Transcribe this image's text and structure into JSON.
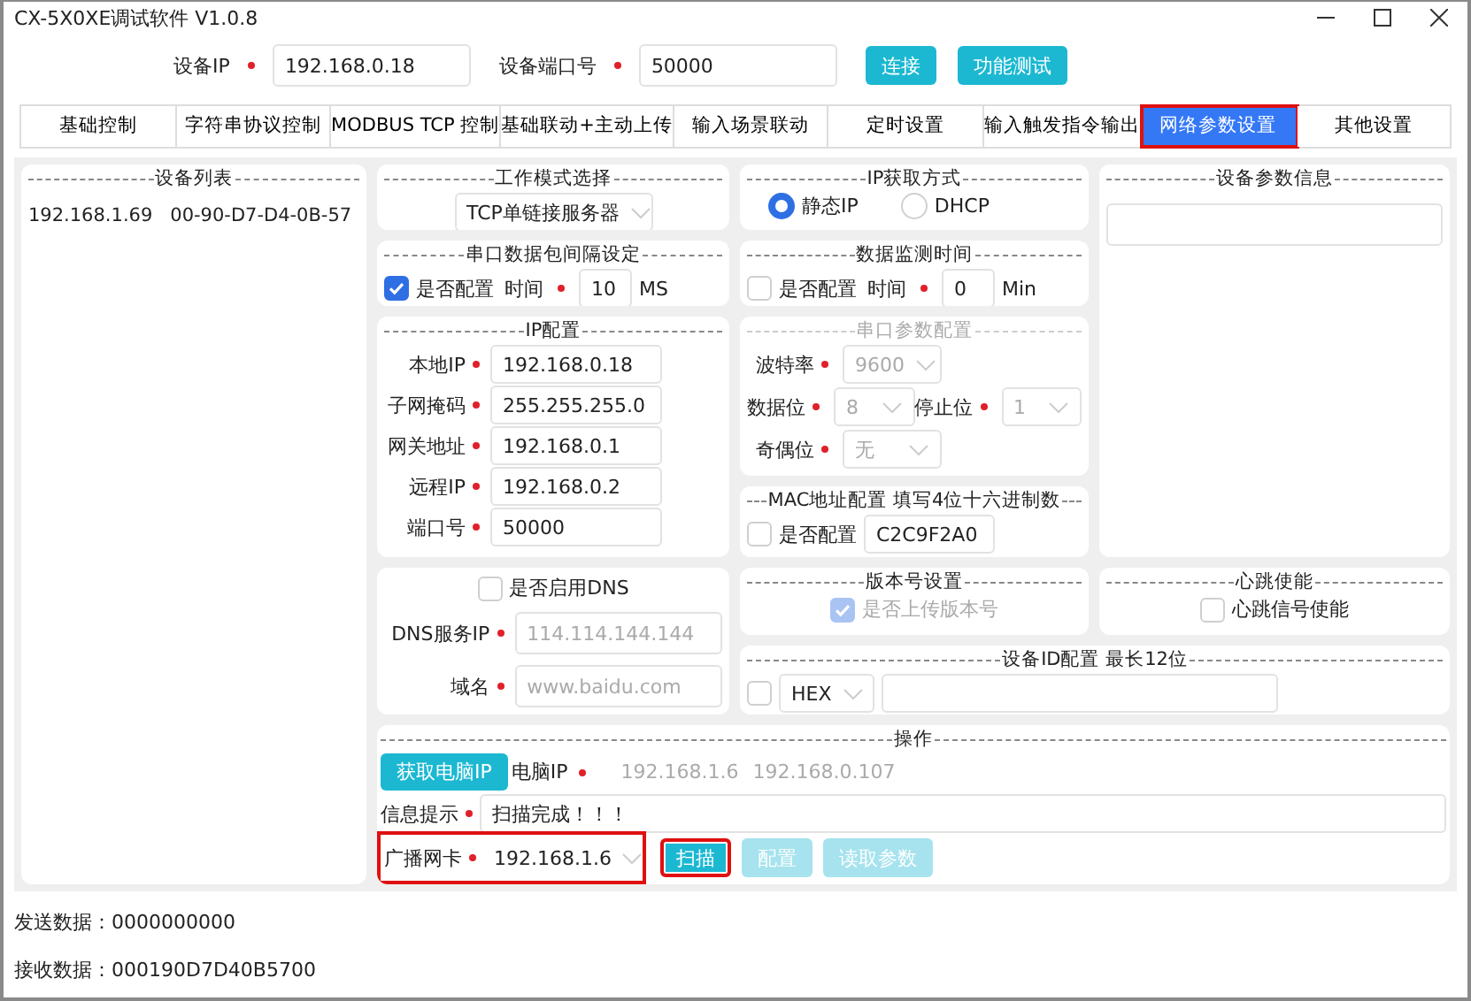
{
  "window": {
    "title": "CX-5X0XE调试软件 V1.0.8"
  },
  "connection": {
    "fields": [
      {
        "label": "设备IP",
        "value": "192.168.0.18"
      },
      {
        "label": "设备端口号",
        "value": "50000"
      }
    ],
    "buttons": [
      "连接",
      "功能测试"
    ]
  },
  "tabs": [
    {
      "label": "基础控制",
      "selected": false,
      "highlighted": false
    },
    {
      "label": "字符串协议控制",
      "selected": false,
      "highlighted": false
    },
    {
      "label": "MODBUS TCP 控制",
      "selected": false,
      "highlighted": false
    },
    {
      "label": "基础联动+主动上传",
      "selected": false,
      "highlighted": false
    },
    {
      "label": "输入场景联动",
      "selected": false,
      "highlighted": false
    },
    {
      "label": "定时设置",
      "selected": false,
      "highlighted": false
    },
    {
      "label": "输入触发指令输出",
      "selected": false,
      "highlighted": false
    },
    {
      "label": "网络参数设置",
      "selected": true,
      "highlighted": true
    },
    {
      "label": "其他设置",
      "selected": false,
      "highlighted": false
    }
  ],
  "device_list": {
    "title": "设备列表",
    "rows": [
      {
        "ip": "192.168.1.69",
        "mac": "00-90-D7-D4-0B-57"
      }
    ]
  },
  "work_mode": {
    "title": "工作模式选择",
    "value": "TCP单链接服务器"
  },
  "ip_acquisition": {
    "title": "IP获取方式",
    "options": [
      {
        "label": "静态IP",
        "selected": true
      },
      {
        "label": "DHCP",
        "selected": false
      }
    ]
  },
  "device_info": {
    "title": "设备参数信息"
  },
  "packet_interval": {
    "title": "串口数据包间隔设定",
    "checkbox": {
      "label": "是否配置",
      "checked": true
    },
    "time_label": "时间",
    "value": "10",
    "unit": "MS"
  },
  "data_monitor": {
    "title": "数据监测时间",
    "checkbox": {
      "label": "是否配置",
      "checked": false
    },
    "time_label": "时间",
    "value": "0",
    "unit": "Min"
  },
  "ip_config": {
    "title": "IP配置",
    "fields": [
      {
        "label": "本地IP",
        "value": "192.168.0.18"
      },
      {
        "label": "子网掩码",
        "value": "255.255.255.0"
      },
      {
        "label": "网关地址",
        "value": "192.168.0.1"
      },
      {
        "label": "远程IP",
        "value": "192.168.0.2"
      },
      {
        "label": "端口号",
        "value": "50000"
      }
    ]
  },
  "serial_params": {
    "title": "串口参数配置",
    "disabled": true,
    "rows": [
      [
        {
          "label": "波特率",
          "value": "9600"
        }
      ],
      [
        {
          "label": "数据位",
          "value": "8"
        },
        {
          "label": "停止位",
          "value": "1"
        }
      ],
      [
        {
          "label": "奇偶位",
          "value": "无"
        }
      ]
    ]
  },
  "mac": {
    "title": "MAC地址配置 填写4位十六进制数",
    "checkbox": {
      "label": "是否配置",
      "checked": false
    },
    "value": "C2C9F2A0"
  },
  "dns": {
    "checkbox": {
      "label": "是否启用DNS",
      "checked": false
    },
    "fields": [
      {
        "label": "DNS服务IP",
        "placeholder": "114.114.144.144"
      },
      {
        "label": "域名",
        "placeholder": "www.baidu.com"
      }
    ]
  },
  "version": {
    "title": "版本号设置",
    "checkbox": {
      "label": "是否上传版本号",
      "checked": true,
      "disabled": true
    }
  },
  "heartbeat": {
    "title": "心跳使能",
    "checkbox": {
      "label": "心跳信号使能",
      "checked": false
    }
  },
  "device_id": {
    "title": "设备ID配置  最长12位",
    "checked": false,
    "format": "HEX"
  },
  "operations": {
    "title": "操作",
    "get_ip_button": "获取电脑IP",
    "pc_ip_label": "电脑IP",
    "pc_ips": [
      "192.168.1.6",
      "192.168.0.107"
    ],
    "message_label": "信息提示",
    "message": "扫描完成！！！",
    "nic": {
      "label": "广播网卡",
      "value": "192.168.1.6",
      "highlighted": true
    },
    "buttons": [
      {
        "label": "扫描",
        "disabled": false,
        "highlighted": true
      },
      {
        "label": "配置",
        "disabled": true,
        "highlighted": false
      },
      {
        "label": "读取参数",
        "disabled": true,
        "highlighted": false
      }
    ]
  },
  "status": [
    {
      "label": "发送数据：",
      "value": "0000000000"
    },
    {
      "label": "接收数据：",
      "value": "000190D7D40B5700"
    }
  ]
}
